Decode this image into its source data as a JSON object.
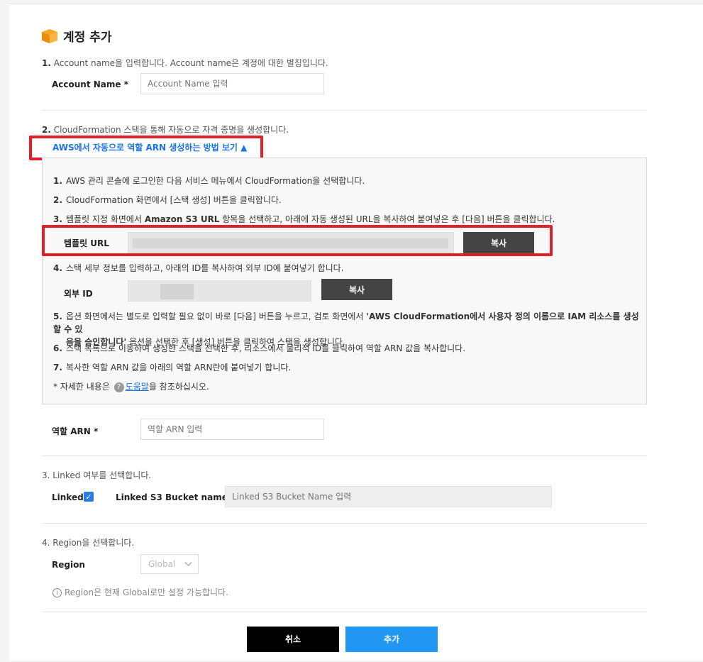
{
  "header": {
    "title": "계정 추가",
    "icon": "box-icon"
  },
  "step1": {
    "num": "1.",
    "text": "Account name을 입력합니다. Account name은 계정에 대한 별칭입니다.",
    "label": "Account Name *",
    "placeholder": "Account Name 입력"
  },
  "step2": {
    "num": "2.",
    "text": "CloudFormation 스택을 통해 자동으로 자격 증명을 생성합니다.",
    "toggle": "AWS에서 자동으로 역할 ARN 생성하는 방법 보기",
    "guide": {
      "s1_num": "1.",
      "s1": "AWS 관리 콘솔에 로그인한 다음 서비스 메뉴에서 CloudFormation을 선택합니다.",
      "s2_num": "2.",
      "s2": "CloudFormation 화면에서 [스택 생성] 버튼을 클릭합니다.",
      "s3_num": "3.",
      "s3_a": "템플릿 지정 화면에서 ",
      "s3_b": "Amazon S3 URL",
      "s3_c": " 항목을 선택하고, 아래에 자동 생성된 URL을 복사하여 붙여넣은 후 [다음] 버튼을 클릭합니다.",
      "template_label": "템플릿 URL",
      "copy_label": "복사",
      "s4_num": "4.",
      "s4": "스택 세부 정보를 입력하고, 아래의 ID를 복사하여 외부 ID에 붙여넣기 합니다.",
      "external_label": "외부 ID",
      "copy_label2": "복사",
      "s5_num": "5.",
      "s5_a": "옵션 화면에서는 별도로 입력할 필요 없이 바로 [다음] 버튼을 누르고, 검토 화면에서 ",
      "s5_b": "'AWS CloudFormation에서 사용자 정의 이름으로 IAM 리소스를 생성할 수 있",
      "s5_c": "음을 승인합니다'",
      "s5_d": " 옵션을 선택한 후 [생성] 버튼을 클릭하여 스택을 생성합니다.",
      "s6_num": "6.",
      "s6": "스택 목록으로 이동하여 생성한 스택을 선택한 후, 리소스에서 물리적 ID를 클릭하여 역할 ARN 값을 복사합니다.",
      "s7_num": "7.",
      "s7": "복사한 역할 ARN 값을 아래의 역할 ARN란에 붙여넣기 합니다.",
      "note_a": "* 자세한 내용은",
      "note_link": "도움말",
      "note_b": "을 참조하십시오."
    },
    "arn_label": "역할 ARN *",
    "arn_placeholder": "역할 ARN 입력"
  },
  "step3": {
    "num": "3.",
    "text": "Linked 여부를 선택합니다.",
    "linked_label": "Linked",
    "linked_checked": true,
    "bucket_label": "Linked S3 Bucket name",
    "bucket_placeholder": "Linked S3 Bucket Name 입력"
  },
  "step4": {
    "num": "4.",
    "text": "Region을 선택합니다.",
    "region_label": "Region",
    "region_value": "Global",
    "info": "Region은 현재 Global로만 설정 가능합니다."
  },
  "footer": {
    "cancel": "취소",
    "add": "추가"
  },
  "colors": {
    "accent": "#2196f3",
    "highlight": "#e0202a",
    "dark_button": "#444444"
  }
}
